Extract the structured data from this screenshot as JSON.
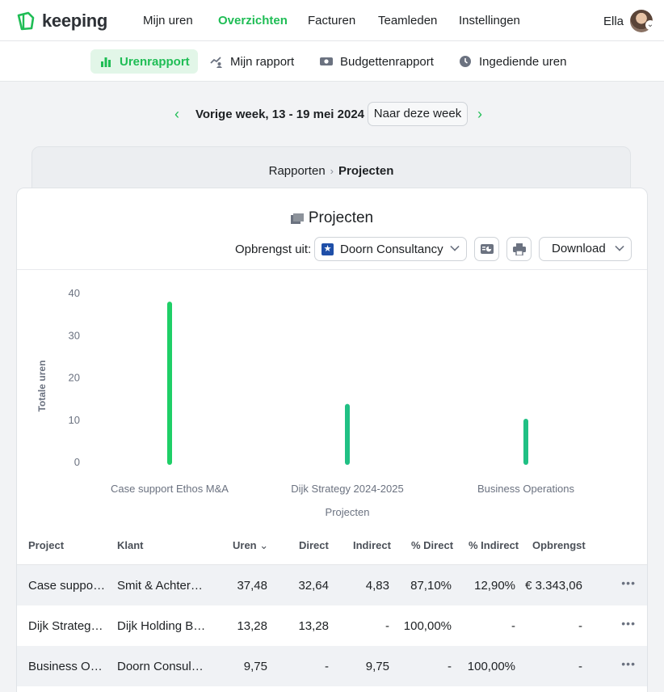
{
  "app": {
    "logo_text": "keeping"
  },
  "nav": {
    "items": [
      "Mijn uren",
      "Overzichten",
      "Facturen",
      "Teamleden",
      "Instellingen"
    ],
    "active_index": 1
  },
  "user": {
    "name": "Ella"
  },
  "subnav": {
    "items": [
      "Urenrapport",
      "Mijn rapport",
      "Budgettenrapport",
      "Ingediende uren"
    ],
    "active_index": 0
  },
  "week": {
    "label": "Vorige week, 13 - 19 mei 2024",
    "this_week_button": "Naar deze week"
  },
  "breadcrumb": {
    "parent": "Rapporten",
    "current": "Projecten"
  },
  "card": {
    "title": "Projecten",
    "revenue_label": "Opbrengst uit:",
    "revenue_source": "Doorn Consultancy",
    "download_label": "Download"
  },
  "colors": {
    "accent": "#1fbd55",
    "bar": "#1fcf67",
    "bar_teal": "#20c084"
  },
  "chart_data": {
    "type": "bar",
    "categories": [
      "Case support Ethos M&A",
      "Dijk Strategy 2024-2025",
      "Business Operations"
    ],
    "values": [
      37.48,
      13.28,
      9.75
    ],
    "title": "",
    "xlabel": "Projecten",
    "ylabel": "Totale uren",
    "ylim": [
      0,
      40
    ],
    "yticks": [
      "0",
      "10",
      "20",
      "30",
      "40"
    ],
    "grid": false
  },
  "table": {
    "headers": [
      "Project",
      "Klant",
      "Uren",
      "Direct",
      "Indirect",
      "% Direct",
      "% Indirect",
      "Opbrengst"
    ],
    "sort_column": "Uren",
    "rows": [
      {
        "project": "Case support Ethos M&A",
        "klant": "Smit & Achterberg",
        "uren": "37,48",
        "direct": "32,64",
        "indirect": "4,83",
        "pct_direct": "87,10%",
        "pct_indirect": "12,90%",
        "opbrengst": "€ 3.343,06"
      },
      {
        "project": "Dijk Strategy 2024-2025",
        "klant": "Dijk Holding B.V.",
        "uren": "13,28",
        "direct": "13,28",
        "indirect": "-",
        "pct_direct": "100,00%",
        "pct_indirect": "-",
        "opbrengst": "-"
      },
      {
        "project": "Business Operations",
        "klant": "Doorn Consultancy",
        "uren": "9,75",
        "direct": "-",
        "indirect": "9,75",
        "pct_direct": "-",
        "pct_indirect": "100,00%",
        "opbrengst": "-"
      }
    ]
  }
}
